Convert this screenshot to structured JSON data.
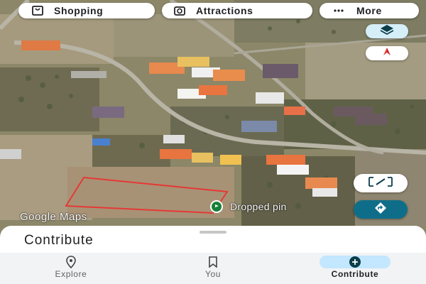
{
  "chips": {
    "shopping": {
      "label": "Shopping",
      "icon": "shopping-bag-icon"
    },
    "attractions": {
      "label": "Attractions",
      "icon": "attractions-icon"
    },
    "more": {
      "label": "More",
      "icon": "more-dots-icon"
    }
  },
  "map": {
    "watermark": "Google Maps",
    "pin_label": "Dropped pin"
  },
  "sheet": {
    "title": "Contribute"
  },
  "nav": {
    "items": [
      {
        "label": "Explore",
        "icon": "location-pin-icon"
      },
      {
        "label": "You",
        "icon": "bookmark-icon"
      },
      {
        "label": "Contribute",
        "icon": "add-circle-icon"
      }
    ],
    "active": "Contribute"
  },
  "colors": {
    "nav_active_pill": "#c2e7ff",
    "layers_button": "#d5eef8",
    "directions_button": "#0e6e8a",
    "pin_green": "#188038",
    "selection_outline": "#e53935"
  }
}
